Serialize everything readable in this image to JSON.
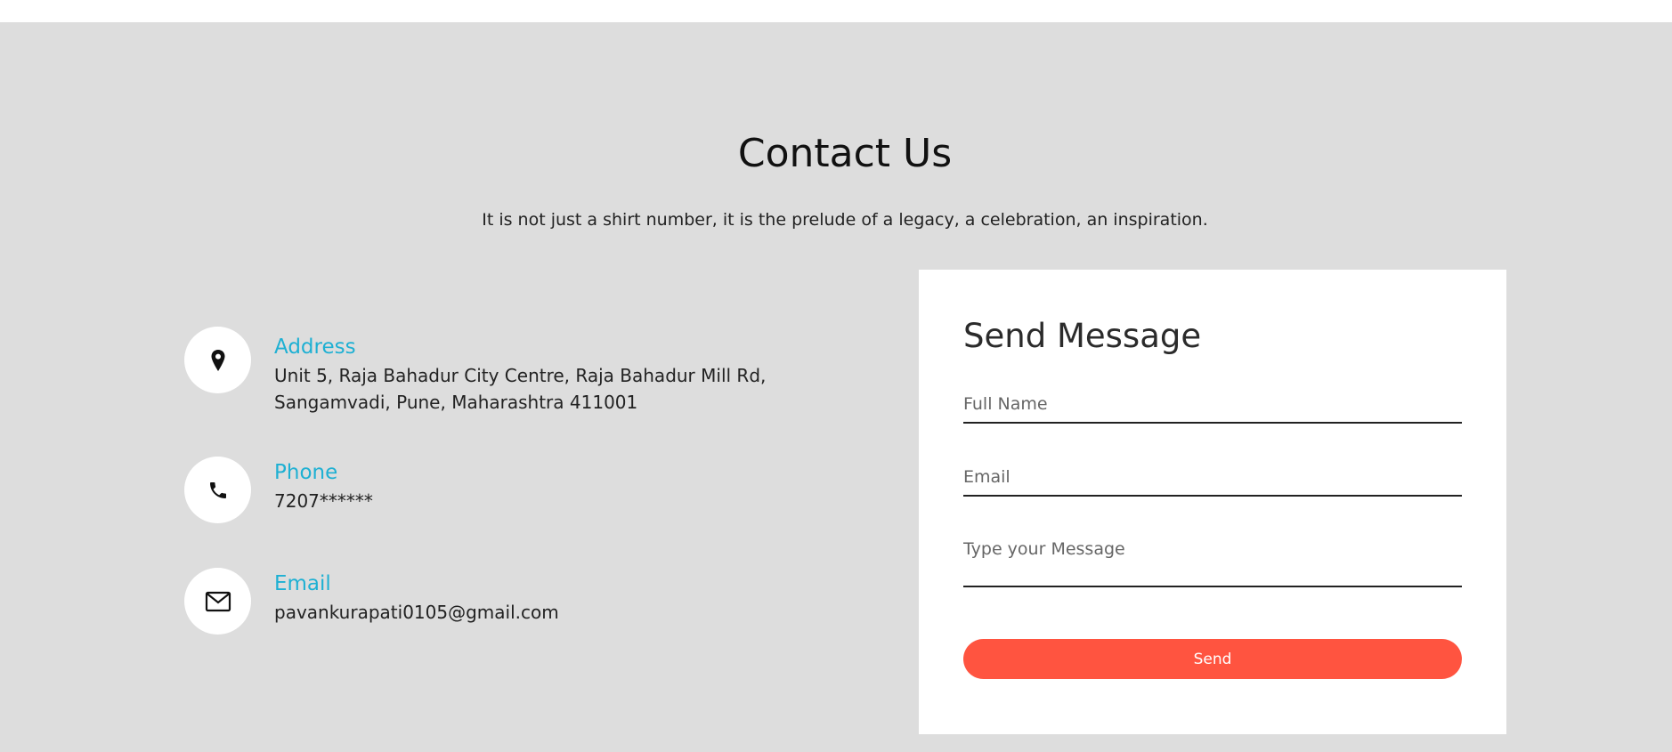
{
  "section": {
    "title": "Contact Us",
    "subtitle": "It is not just a shirt number, it is the prelude of a legacy, a celebration, an inspiration."
  },
  "contact_info": {
    "address": {
      "icon": "map-pin-icon",
      "heading": "Address",
      "line1": "Unit 5, Raja Bahadur City Centre, Raja Bahadur Mill Rd,",
      "line2": "Sangamvadi, Pune, Maharashtra 411001"
    },
    "phone": {
      "icon": "phone-icon",
      "heading": "Phone",
      "value": "7207******"
    },
    "email": {
      "icon": "envelope-icon",
      "heading": "Email",
      "value": "pavankurapati0105@gmail.com"
    },
    "heading_color": "#1eb0d3"
  },
  "form": {
    "title": "Send Message",
    "full_name_placeholder": "Full Name",
    "email_placeholder": "Email",
    "message_placeholder": "Type your Message",
    "send_label": "Send",
    "button_color": "#ff5440"
  }
}
